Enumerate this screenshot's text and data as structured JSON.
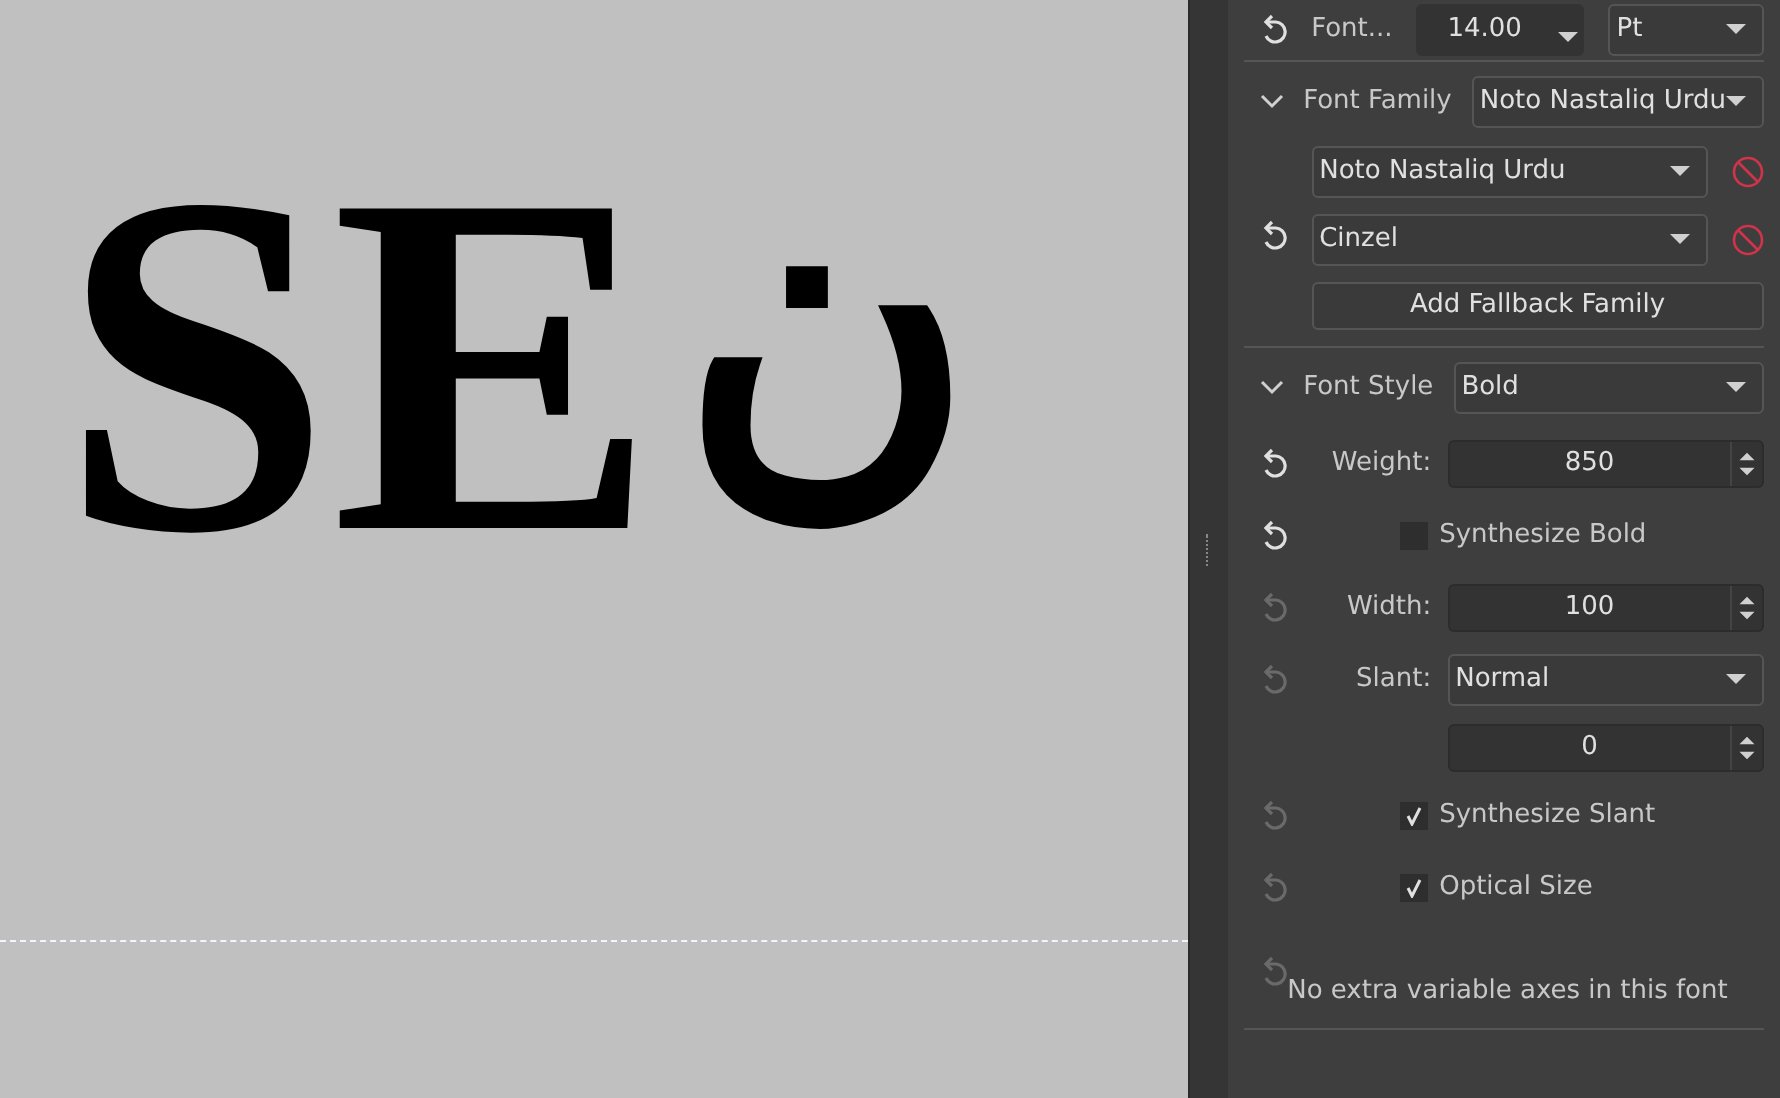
{
  "canvas": {
    "texts": [
      "SE",
      "ن"
    ]
  },
  "panel": {
    "font_size": {
      "label": "Font...",
      "value": "14.00",
      "unit": "Pt",
      "reset_enabled": true
    },
    "font_family": {
      "label": "Font Family",
      "expanded": true,
      "value": "Noto Nastaliq Urdu",
      "reset_enabled": true,
      "fallbacks": [
        {
          "value": "Noto Nastaliq Urdu"
        },
        {
          "value": "Cinzel"
        }
      ],
      "add_button": "Add Fallback Family"
    },
    "font_style": {
      "label": "Font Style",
      "expanded": true,
      "value": "Bold",
      "rows": [
        {
          "kind": "spin",
          "label": "Weight:",
          "value": "850",
          "reset_enabled": true
        },
        {
          "kind": "check",
          "label": "Synthesize Bold",
          "checked": false,
          "reset_enabled": true
        },
        {
          "kind": "spin",
          "label": "Width:",
          "value": "100",
          "reset_enabled": false
        },
        {
          "kind": "select",
          "label": "Slant:",
          "value": "Normal",
          "reset_enabled": false
        },
        {
          "kind": "spin",
          "value": "0"
        },
        {
          "kind": "check",
          "label": "Synthesize Slant",
          "checked": true,
          "reset_enabled": false
        },
        {
          "kind": "check",
          "label": "Optical Size",
          "checked": true,
          "reset_enabled": false
        },
        {
          "kind": "note",
          "text": "No extra variable axes in this font",
          "reset_enabled": false
        }
      ]
    }
  }
}
